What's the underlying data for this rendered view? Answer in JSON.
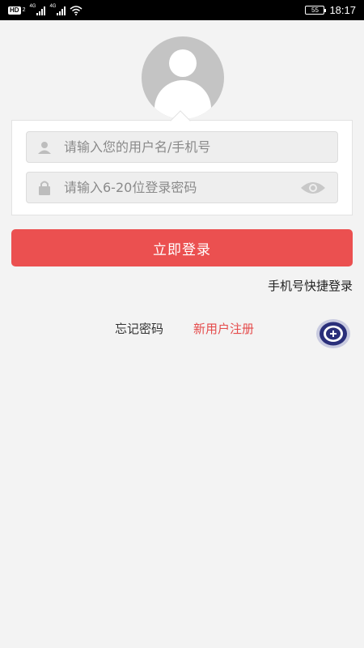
{
  "status_bar": {
    "hd_label": "HD",
    "hd_sub": "2",
    "network_1": "4G",
    "network_2": "4G",
    "battery": "55",
    "time": "18:17"
  },
  "login": {
    "username_placeholder": "请输入您的用户名/手机号",
    "password_placeholder": "请输入6-20位登录密码",
    "submit_label": "立即登录",
    "quick_login_label": "手机号快捷登录",
    "forgot_label": "忘记密码",
    "register_label": "新用户注册"
  },
  "icons": {
    "avatar": "avatar-placeholder-icon",
    "user": "user-icon",
    "lock": "lock-icon",
    "eye": "eye-icon",
    "float": "plus-circle-icon"
  },
  "colors": {
    "primary": "#eb5050",
    "register_text": "#e54b4b",
    "fab": "#2a2f7a"
  }
}
